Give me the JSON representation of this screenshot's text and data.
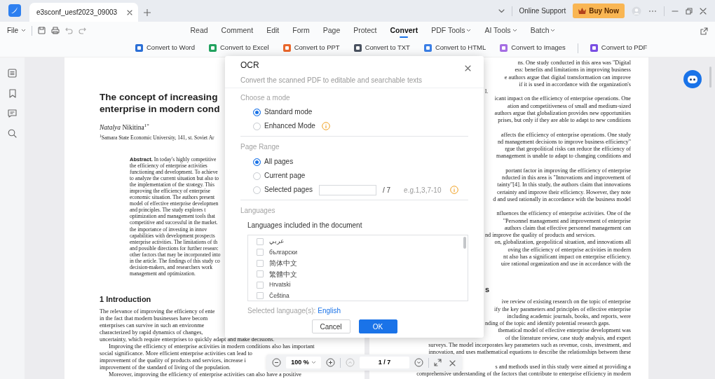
{
  "app": {
    "tab": "e3sconf_uesf2023_09003",
    "support": "Online Support",
    "buy": "Buy Now"
  },
  "toolbar": {
    "file": "File",
    "tabs": [
      {
        "label": "Read",
        "selected": false,
        "dropdown": false
      },
      {
        "label": "Comment",
        "selected": false,
        "dropdown": false
      },
      {
        "label": "Edit",
        "selected": false,
        "dropdown": false
      },
      {
        "label": "Form",
        "selected": false,
        "dropdown": false
      },
      {
        "label": "Page",
        "selected": false,
        "dropdown": false
      },
      {
        "label": "Protect",
        "selected": false,
        "dropdown": false
      },
      {
        "label": "Convert",
        "selected": true,
        "dropdown": false
      },
      {
        "label": "PDF Tools",
        "selected": false,
        "dropdown": true
      },
      {
        "label": "AI Tools",
        "selected": false,
        "dropdown": true
      },
      {
        "label": "Batch",
        "selected": false,
        "dropdown": true
      }
    ]
  },
  "convert_tools": [
    {
      "label": "Convert to Word",
      "color": "#2b6fd6"
    },
    {
      "label": "Convert to Excel",
      "color": "#22a25f"
    },
    {
      "label": "Convert to PPT",
      "color": "#e9672c"
    },
    {
      "label": "Convert to TXT",
      "color": "#4a5260"
    },
    {
      "label": "Convert to HTML",
      "color": "#3a7fe6"
    },
    {
      "label": "Convert to Images",
      "color": "#a56ee3"
    },
    {
      "label": "Convert to PDF",
      "color": "#7a4fe3",
      "separator_before": true
    }
  ],
  "document": {
    "title": [
      "The concept of increasing",
      "enterprise in modern cond"
    ],
    "author": "*Natalya* Nikitina$^{1*}$",
    "affiliation": "$^{1}$Samara State Economic University, 141, st. Soviet Ar",
    "abstract": [
      "**Abstract.** In today's highly competitive",
      "the efficiency of enterprise activities",
      "functioning and development. To achieve",
      "to analyze the current situation but also to",
      "the implementation of the strategy. This",
      "improving the efficiency of enterprise",
      "economic situation. The authors present",
      "model of effective enterprise developmen",
      "and principles. The study explores t",
      "optimization and management tools that",
      "competitive and successful in the market.",
      "the importance of investing in innov",
      "capabilities with development prospects",
      "enterprise activities. The limitations of th",
      "and possible directions for further researc",
      "other factors that may be incorporated into",
      "in the article. The findings of this study co",
      "decision-makers, and researchers work",
      "management and optimization."
    ],
    "heading": "1 Introduction",
    "intro": [
      {
        "text": "The relevance of improving the efficiency of ente"
      },
      {
        "text": "in the fact that modern businesses have becom"
      },
      {
        "text": "enterprises can survive in such an environme"
      },
      {
        "text": "characterized by rapid dynamics of changes,"
      },
      {
        "text": "uncertainty, which require enterprises to quickly adapt and make decisions."
      },
      {
        "text": "Improving the efficiency of enterprise activities in modern conditions also has important",
        "indent": true
      },
      {
        "text": "social significance. More efficient enterprise activities can lead to"
      },
      {
        "text": "improvement of the quality of products and services, increase i"
      },
      {
        "text": "improvement of the standard of living of the population."
      },
      {
        "text": "Moreover, improving the efficiency of enterprise activities can also have a positive",
        "indent": true
      }
    ],
    "right": [
      {
        "kind": "line",
        "text": "ns. One study conducted in this area was \"Digital"
      },
      {
        "kind": "line",
        "text": "ess: benefits and limitations in improving business"
      },
      {
        "kind": "line",
        "text": "e authors argue that digital transformation can improve"
      },
      {
        "kind": "line",
        "text": "if it is used in accordance with the organization's"
      },
      {
        "kind": "line",
        "text": "l.",
        "end": true
      },
      {
        "kind": "line",
        "text": "icant impact on the efficiency of enterprise operations. One"
      },
      {
        "kind": "line",
        "text": "ation and competitiveness of small and medium-sized"
      },
      {
        "kind": "line",
        "text": "authors argue that globalization provides new opportunities"
      },
      {
        "kind": "line",
        "text": "prises, but only if they are able to adapt to new conditions"
      },
      {
        "kind": "line",
        "text": "affects the efficiency of enterprise operations. One study",
        "break": true
      },
      {
        "kind": "line",
        "text": "nd management decisions to improve business efficiency\""
      },
      {
        "kind": "line",
        "text": "rgue that geopolitical risks can reduce the efficiency of"
      },
      {
        "kind": "line",
        "text": "management is unable to adapt to changing conditions and"
      },
      {
        "kind": "line",
        "text": "portant factor in improving the efficiency of enterprise",
        "break": true
      },
      {
        "kind": "line",
        "text": "nducted in this area is \"Innovations and improvement of"
      },
      {
        "kind": "line",
        "text": "tainty\"[4]. In this study, the authors claim that innovations"
      },
      {
        "kind": "line",
        "text": "certainty and improve their efficiency. However, they note"
      },
      {
        "kind": "line",
        "text": "d and used rationally in accordance with the business model"
      },
      {
        "kind": "line",
        "text": "nfluences the efficiency of enterprise activities. One of the",
        "break": true
      },
      {
        "kind": "line",
        "text": "\"Personnel management and improvement of enterprise"
      },
      {
        "kind": "line",
        "text": "authors claim that effective personnel management can"
      },
      {
        "kind": "line",
        "text": "nd improve the quality of products and services.",
        "end": true
      },
      {
        "kind": "line",
        "text": "on, globalization, geopolitical situation, and innovations all"
      },
      {
        "kind": "line",
        "text": "oving the efficiency of enterprise activities in modern"
      },
      {
        "kind": "line",
        "text": "nt also has a significant impact on enterprise efficiency."
      },
      {
        "kind": "line",
        "text": "uire rational organization and use in accordance with the"
      },
      {
        "kind": "heading",
        "text": "s"
      },
      {
        "kind": "line",
        "text": "ive review of existing research on the topic of enterprise"
      },
      {
        "kind": "line",
        "text": "ify the key parameters and principles of effective enterprise"
      },
      {
        "kind": "line",
        "text": "including academic journals, books, and reports, were"
      },
      {
        "kind": "line",
        "text": "nding of the topic and identify potential research gaps.",
        "end": true
      },
      {
        "kind": "line",
        "text": "thematical model of effective enterprise development was"
      },
      {
        "kind": "line",
        "text": "of the literature review, case study analysis, and expert"
      },
      {
        "kind": "line",
        "text": "surveys. The model incorporates key parameters such as revenue, costs, investment, and"
      },
      {
        "kind": "line",
        "text": "innovation, and uses mathematical equations to describe the relationships between these"
      },
      {
        "kind": "line",
        "text": "s and methods used in this study were aimed at providing a",
        "break": true
      },
      {
        "kind": "line",
        "text": "comprehensive understanding of the factors that contribute to enterprise efficiency in modern"
      }
    ]
  },
  "dialog": {
    "title": "OCR",
    "subtitle": "Convert the scanned PDF to editable and searchable texts",
    "mode_label": "Choose a mode",
    "modes": [
      {
        "label": "Standard mode",
        "selected": true
      },
      {
        "label": "Enhanced Mode",
        "selected": false,
        "info": true
      }
    ],
    "range_label": "Page Range",
    "ranges": [
      {
        "label": "All pages",
        "selected": true,
        "kind": "plain"
      },
      {
        "label": "Current page",
        "selected": false,
        "kind": "plain"
      },
      {
        "label": "Selected pages",
        "selected": false,
        "kind": "input"
      }
    ],
    "page_total": "/ 7",
    "page_hint": "e.g.1,3,7-10",
    "languages_label": "Languages",
    "languages_caption": "Languages included in the document",
    "languages": [
      {
        "label": "عربي",
        "checked": false
      },
      {
        "label": "български",
        "checked": false
      },
      {
        "label": "简体中文",
        "checked": false
      },
      {
        "label": "繁體中文",
        "checked": false
      },
      {
        "label": "Hrvatski",
        "checked": false
      },
      {
        "label": "Čeština",
        "checked": false
      }
    ],
    "selected_caption": "Selected language(s):",
    "selected_value": "English",
    "buttons": [
      {
        "label": "Cancel",
        "kind": "secondary"
      },
      {
        "label": "OK",
        "kind": "primary"
      }
    ]
  },
  "page_nav": {
    "zoom": "100 %",
    "page": "1 / 7"
  }
}
